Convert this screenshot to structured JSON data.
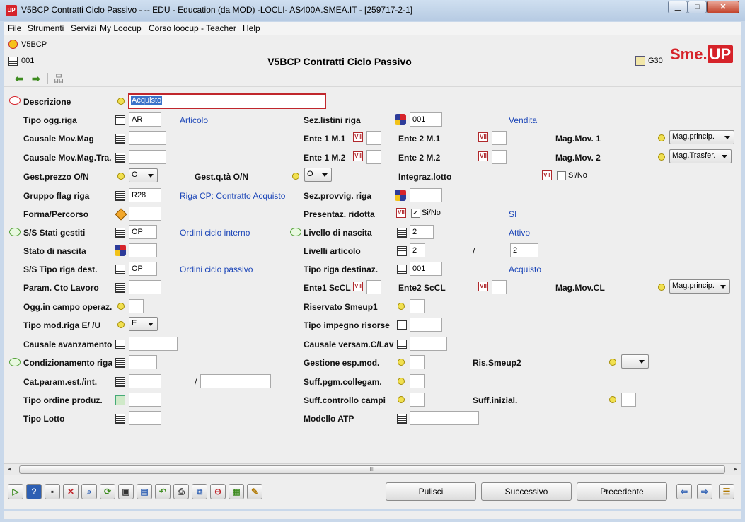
{
  "window": {
    "title": "V5BCP Contratti Ciclo Passivo -  -- EDU - Education (da MOD) -LOCLI- AS400A.SMEA.IT - [259717-2-1]",
    "app_icon": "UP",
    "min": "▁",
    "max": "□",
    "close": "✕"
  },
  "menu": [
    "File",
    "Strumenti",
    "Servizi",
    "My Loocup",
    "Corso loocup - Teacher",
    "Help"
  ],
  "header": {
    "code": "V5BCP",
    "number": "001",
    "title": "V5BCP Contratti Ciclo Passivo",
    "g30": "G30",
    "logo_sme": "Sme.",
    "logo_up": "UP"
  },
  "toolbar": {
    "back": "⇐",
    "forward": "⇒",
    "network": "品"
  },
  "form": {
    "descrizione": {
      "label": "Descrizione",
      "value": "Acquisto"
    },
    "tipo_ogg_riga": {
      "label": "Tipo ogg.riga",
      "value": "AR",
      "desc": "Articolo"
    },
    "sez_listini_riga": {
      "label": "Sez.listini riga",
      "value": "001",
      "desc": "Vendita"
    },
    "causale_mov_mag": {
      "label": "Causale Mov.Mag",
      "value": ""
    },
    "ente1_m1": {
      "label": "Ente 1 M.1",
      "value": ""
    },
    "ente2_m1": {
      "label": "Ente 2 M.1",
      "value": ""
    },
    "mag_mov1": {
      "label": "Mag.Mov. 1",
      "value": "Mag.princip."
    },
    "causale_mov_mag_tra": {
      "label": "Causale Mov.Mag.Tra.",
      "value": ""
    },
    "ente1_m2": {
      "label": "Ente 1 M.2",
      "value": ""
    },
    "ente2_m2": {
      "label": "Ente 2 M.2",
      "value": ""
    },
    "mag_mov2": {
      "label": "Mag.Mov. 2",
      "value": "Mag.Trasfer."
    },
    "gest_prezzo": {
      "label": "Gest.prezzo O/N",
      "value": "O"
    },
    "gest_qta": {
      "label": "Gest.q.tà  O/N",
      "value": "O"
    },
    "integraz_lotto": {
      "label": "Integraz.lotto",
      "check_label": "Si/No",
      "checked": false
    },
    "gruppo_flag": {
      "label": "Gruppo flag riga",
      "value": "R28",
      "desc": "Riga CP: Contratto Acquisto"
    },
    "sez_provvig": {
      "label": "Sez.provvig. riga",
      "value": ""
    },
    "forma_percorso": {
      "label": "Forma/Percorso",
      "value": ""
    },
    "presentaz_ridotta": {
      "label": "Presentaz. ridotta",
      "check_label": "Si/No",
      "checked": true,
      "check_mark": "✓",
      "desc": "SI"
    },
    "ss_stati_gestiti": {
      "label": "S/S Stati gestiti",
      "value": "OP",
      "desc": "Ordini ciclo interno"
    },
    "livello_nascita": {
      "label": "Livello di nascita",
      "value": "2",
      "desc": "Attivo"
    },
    "stato_nascita": {
      "label": "Stato di nascita",
      "value": ""
    },
    "livelli_articolo": {
      "label": "Livelli articolo",
      "value1": "2",
      "sep": "/",
      "value2": "2"
    },
    "ss_tipo_riga_dest": {
      "label": "S/S Tipo riga dest.",
      "value": "OP",
      "desc": "Ordini ciclo passivo"
    },
    "tipo_riga_destinaz": {
      "label": "Tipo riga destinaz.",
      "value": "001",
      "desc": "Acquisto"
    },
    "param_cto_lavoro": {
      "label": "Param. Cto Lavoro",
      "value": ""
    },
    "ente1_sccl": {
      "label": "Ente1 ScCL",
      "value": ""
    },
    "ente2_sccl": {
      "label": "Ente2 ScCL",
      "value": ""
    },
    "mag_mov_cl": {
      "label": "Mag.Mov.CL",
      "value": "Mag.princip."
    },
    "ogg_campo_operaz": {
      "label": "Ogg.in campo operaz.",
      "value": ""
    },
    "riservato_smeup1": {
      "label": "Riservato Smeup1",
      "value": ""
    },
    "tipo_mod_riga": {
      "label": "Tipo mod.riga E/ /U",
      "value": "E"
    },
    "tipo_impegno_risorse": {
      "label": "Tipo impegno risorse",
      "value": ""
    },
    "causale_avanzamento": {
      "label": "Causale avanzamento",
      "value": ""
    },
    "causale_versam": {
      "label": "Causale versam.C/Lav",
      "value": ""
    },
    "condizionamento_riga": {
      "label": "Condizionamento riga",
      "value": ""
    },
    "gestione_esp_mod": {
      "label": "Gestione esp.mod.",
      "value": ""
    },
    "ris_smeup2": {
      "label": "Ris.Smeup2",
      "value": ""
    },
    "cat_param": {
      "label": "Cat.param.est./int.",
      "value1": "",
      "sep": "/",
      "value2": ""
    },
    "suff_pgm_collegam": {
      "label": "Suff.pgm.collegam.",
      "value": ""
    },
    "tipo_ordine_produz": {
      "label": "Tipo ordine produz.",
      "value": ""
    },
    "suff_controllo_campi": {
      "label": "Suff.controllo campi",
      "value": ""
    },
    "suff_inizial": {
      "label": "Suff.inizial.",
      "value": ""
    },
    "tipo_lotto": {
      "label": "Tipo Lotto",
      "value": ""
    },
    "modello_atp": {
      "label": "Modello ATP",
      "value": ""
    }
  },
  "scrollbar": {
    "left": "◂",
    "right": "▸",
    "grip": "III"
  },
  "bottom": {
    "icons": [
      "▷",
      "?",
      "▪",
      "✕",
      "⌕",
      "⟳",
      "▣",
      "▤",
      "↶",
      "⎙",
      "⧉",
      "⊖",
      "▦",
      "✎"
    ],
    "buttons": {
      "pulisci": "Pulisci",
      "successivo": "Successivo",
      "precedente": "Precedente"
    },
    "nav": {
      "prev": "⇦",
      "next": "⇨",
      "list": "☰"
    }
  }
}
